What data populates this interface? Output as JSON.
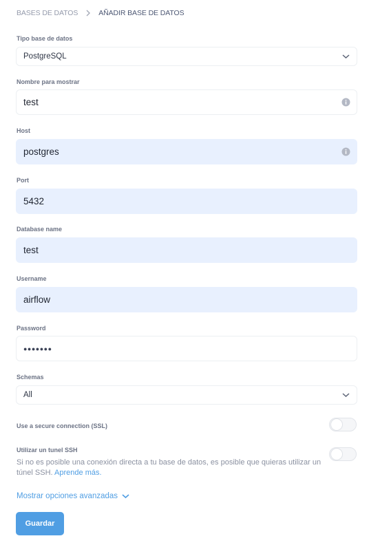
{
  "breadcrumb": {
    "parent": "BASES DE DATOS",
    "separator_icon": "chevron-right-icon",
    "current": "AÑADIR BASE DE DATOS"
  },
  "form": {
    "db_type": {
      "label": "Tipo base de datos",
      "value": "PostgreSQL",
      "icon": "chevron-down-icon"
    },
    "display_name": {
      "label": "Nombre para mostrar",
      "value": "test",
      "icon": "info-icon"
    },
    "host": {
      "label": "Host",
      "value": "postgres",
      "icon": "info-icon"
    },
    "port": {
      "label": "Port",
      "value": "5432"
    },
    "database_name": {
      "label": "Database name",
      "value": "test"
    },
    "username": {
      "label": "Username",
      "value": "airflow"
    },
    "password": {
      "label": "Password",
      "value": "●●●●●●●"
    },
    "schemas": {
      "label": "Schemas",
      "value": "All",
      "icon": "chevron-down-icon"
    },
    "ssl": {
      "label": "Use a secure connection (SSL)",
      "enabled": false
    },
    "ssh": {
      "label": "Utilizar un tunel SSH",
      "enabled": false,
      "description": "Si no es posible una conexión directa a tu base de datos, es posible que quieras utilizar un túnel SSH.",
      "link": "Aprende más."
    },
    "advanced": {
      "label": "Mostrar opciones avanzadas",
      "icon": "chevron-down-icon"
    },
    "save_label": "Guardar"
  },
  "colors": {
    "accent": "#509ee3",
    "autofill_bg": "#e8f0fe"
  }
}
